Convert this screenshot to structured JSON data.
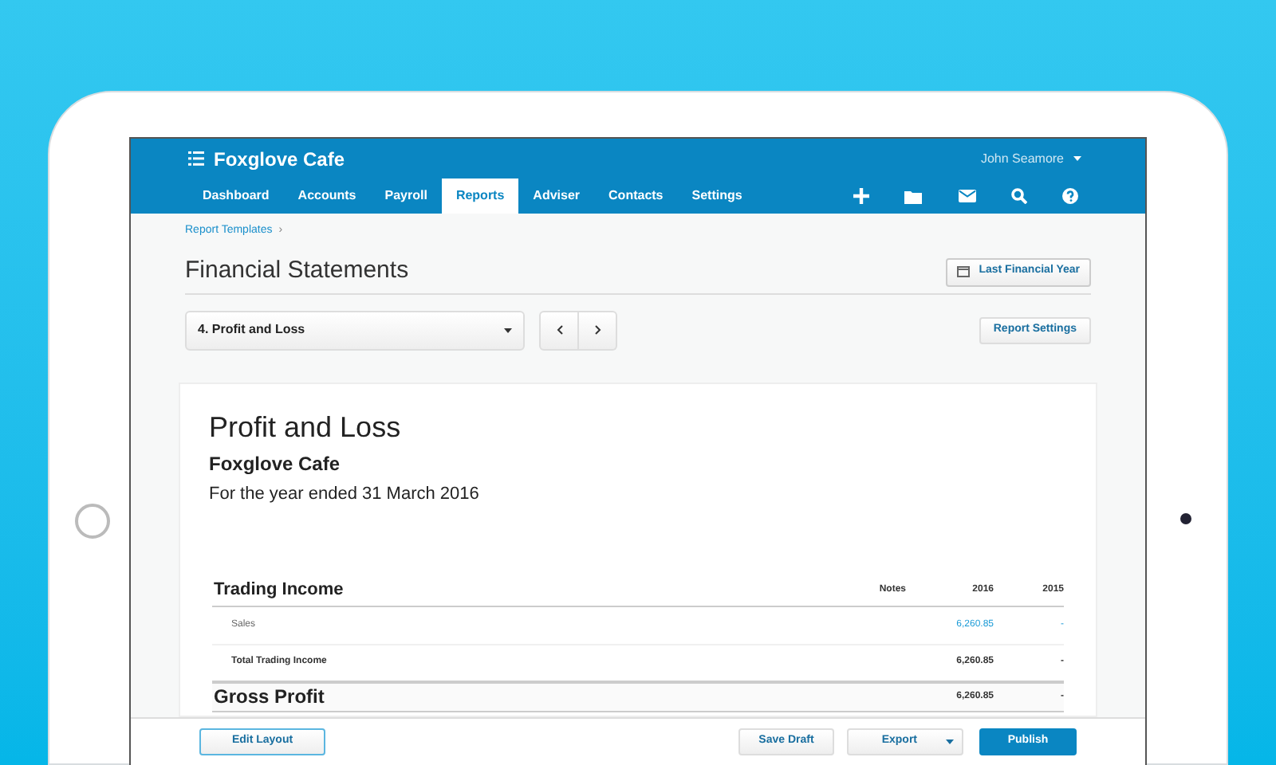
{
  "app": {
    "title": "Foxglove Cafe",
    "user": "John Seamore"
  },
  "nav": [
    {
      "label": "Dashboard",
      "selected": false
    },
    {
      "label": "Accounts",
      "selected": false
    },
    {
      "label": "Payroll",
      "selected": false
    },
    {
      "label": "Reports",
      "selected": true
    },
    {
      "label": "Adviser",
      "selected": false
    },
    {
      "label": "Contacts",
      "selected": false
    },
    {
      "label": "Settings",
      "selected": false
    }
  ],
  "breadcrumb": [
    "Report Templates",
    "›"
  ],
  "page_title": "Financial Statements",
  "period_button": "Last Financial Year",
  "report_select": "4. Profit and Loss",
  "report_settings_button": "Report Settings",
  "report": {
    "title": "Profit and Loss",
    "company": "Foxglove Cafe",
    "period": "For the year ended 31 March 2016",
    "rows": [
      {
        "kind": "heading",
        "label": "Trading Income",
        "notes": "Notes",
        "current": "2016",
        "prior": "2015"
      },
      {
        "kind": "line",
        "label": "Sales",
        "current": "6,260.85",
        "prior": "-"
      },
      {
        "kind": "total",
        "label": "Total Trading Income",
        "current": "6,260.85",
        "prior": "-"
      },
      {
        "kind": "grand",
        "label": "Gross Profit",
        "current": "6,260.85",
        "prior": "-"
      }
    ]
  },
  "footer": {
    "left": "Edit Layout",
    "save": "Save Draft",
    "export": "Export",
    "publish": "Publish"
  }
}
